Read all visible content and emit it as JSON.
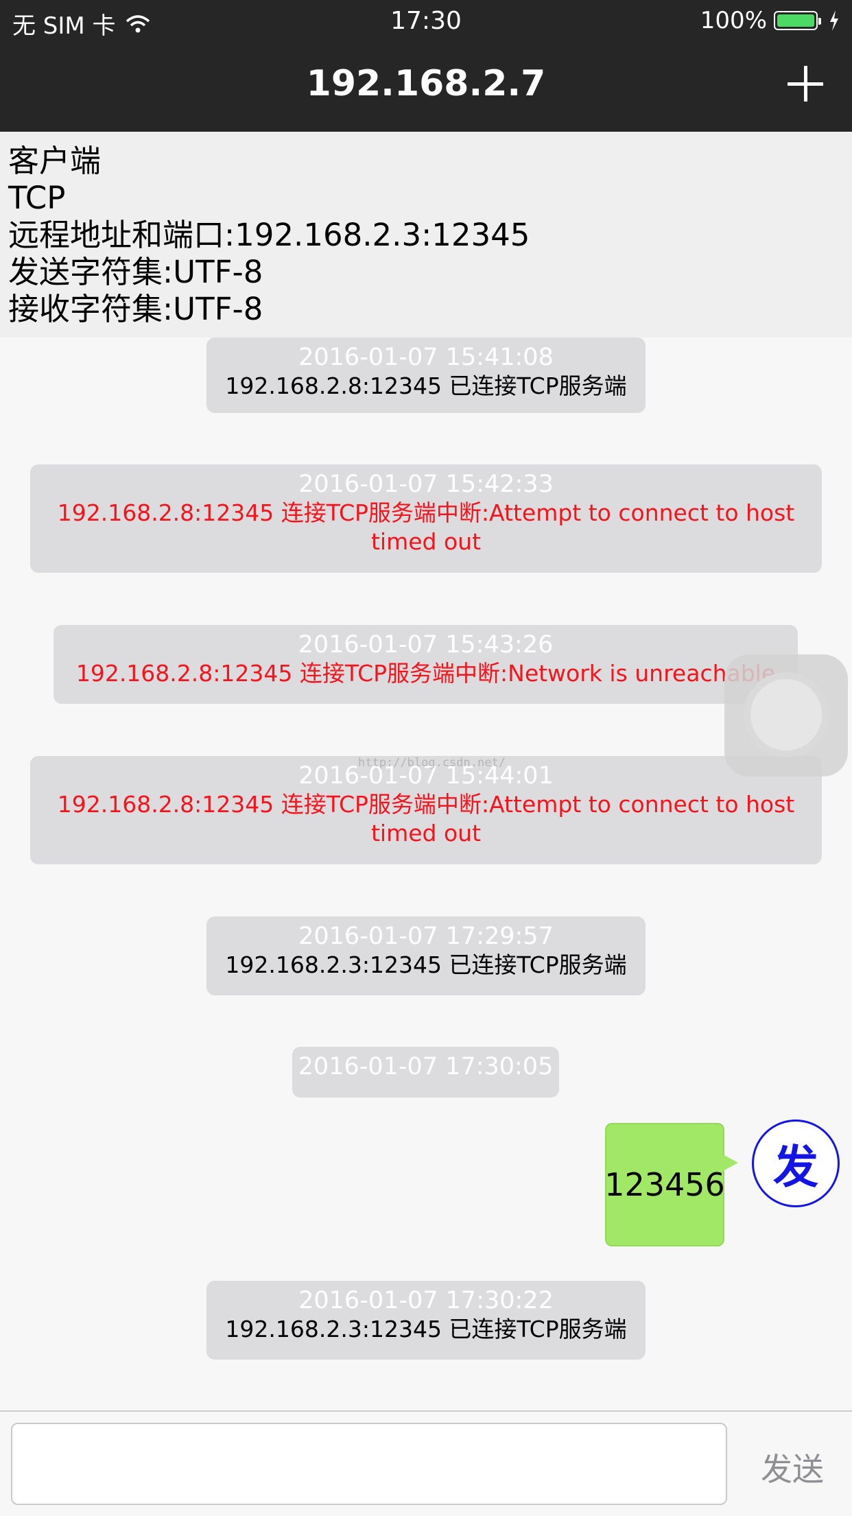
{
  "status_bar": {
    "carrier": "无 SIM 卡",
    "time": "17:30",
    "battery_percent": "100%",
    "battery_level": 1.0,
    "wifi_icon": "wifi-icon",
    "charging_icon": "bolt-icon"
  },
  "nav": {
    "title": "192.168.2.7",
    "add_icon": "plus-icon"
  },
  "info": {
    "role": "客户端",
    "protocol": "TCP",
    "remote": "远程地址和端口:192.168.2.3:12345",
    "send_charset": "发送字符集:UTF-8",
    "recv_charset": "接收字符集:UTF-8"
  },
  "messages": [
    {
      "time": "2016-01-07 15:41:08",
      "text": "192.168.2.8:12345 已连接TCP服务端"
    },
    {
      "time": "2016-01-07 15:42:33",
      "text": "192.168.2.8:12345 连接TCP服务端中断:Attempt to connect to host timed out"
    },
    {
      "time": "2016-01-07 15:43:26",
      "text": "192.168.2.8:12345 连接TCP服务端中断:Network is unreachable"
    },
    {
      "time": "2016-01-07 15:44:01",
      "text": "192.168.2.8:12345 连接TCP服务端中断:Attempt to connect to host timed out"
    },
    {
      "time": "2016-01-07 17:29:57",
      "text": "192.168.2.3:12345 已连接TCP服务端"
    },
    {
      "time": "2016-01-07 17:30:05"
    },
    {
      "time": "2016-01-07 17:30:22",
      "text": "192.168.2.3:12345 已连接TCP服务端"
    }
  ],
  "sent_bubble": {
    "text": "123456",
    "avatar_label": "发"
  },
  "watermark": "http://blog.csdn.net/",
  "input_bar": {
    "value": "",
    "placeholder": "",
    "send_label": "发送"
  },
  "colors": {
    "error_text": "#f5141b",
    "bubble_green": "#a1e866",
    "avatar_blue": "#1414e6"
  }
}
